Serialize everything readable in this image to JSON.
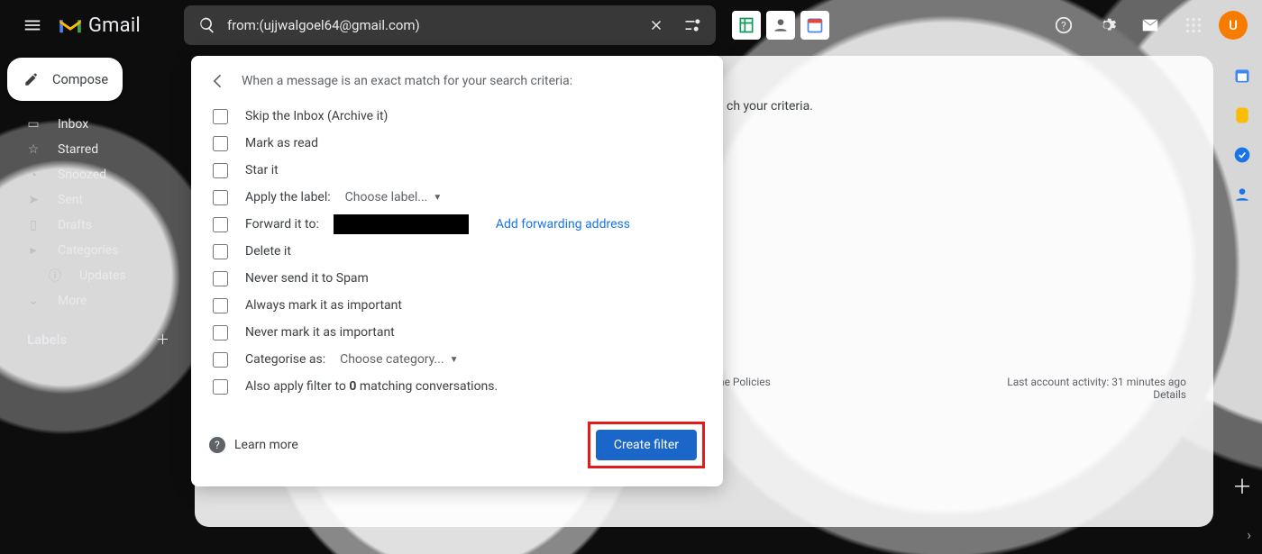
{
  "header": {
    "product": "Gmail",
    "search_value": "from:(ujjwalgoel64@gmail.com)",
    "avatar_initial": "U"
  },
  "compose_label": "Compose",
  "nav": {
    "inbox": "Inbox",
    "starred": "Starred",
    "snoozed": "Snoozed",
    "sent": "Sent",
    "drafts": "Drafts",
    "categories": "Categories",
    "updates": "Updates",
    "more": "More"
  },
  "labels_heading": "Labels",
  "canvas": {
    "no_match_suffix": "ch your criteria.",
    "policies": "amme Policies",
    "activity": "Last account activity: 31 minutes ago",
    "details": "Details"
  },
  "filter": {
    "heading": "When a message is an exact match for your search criteria:",
    "skip_inbox": "Skip the Inbox (Archive it)",
    "mark_read": "Mark as read",
    "star": "Star it",
    "apply_label": "Apply the label:",
    "apply_label_sel": "Choose label...",
    "forward": "Forward it to:",
    "add_forward": "Add forwarding address",
    "delete": "Delete it",
    "never_spam": "Never send it to Spam",
    "always_imp": "Always mark it as important",
    "never_imp": "Never mark it as important",
    "categorise": "Categorise as:",
    "categorise_sel": "Choose category...",
    "also_prefix": "Also apply filter to ",
    "also_count": "0",
    "also_suffix": " matching conversations.",
    "learn_more": "Learn more",
    "create": "Create filter"
  }
}
